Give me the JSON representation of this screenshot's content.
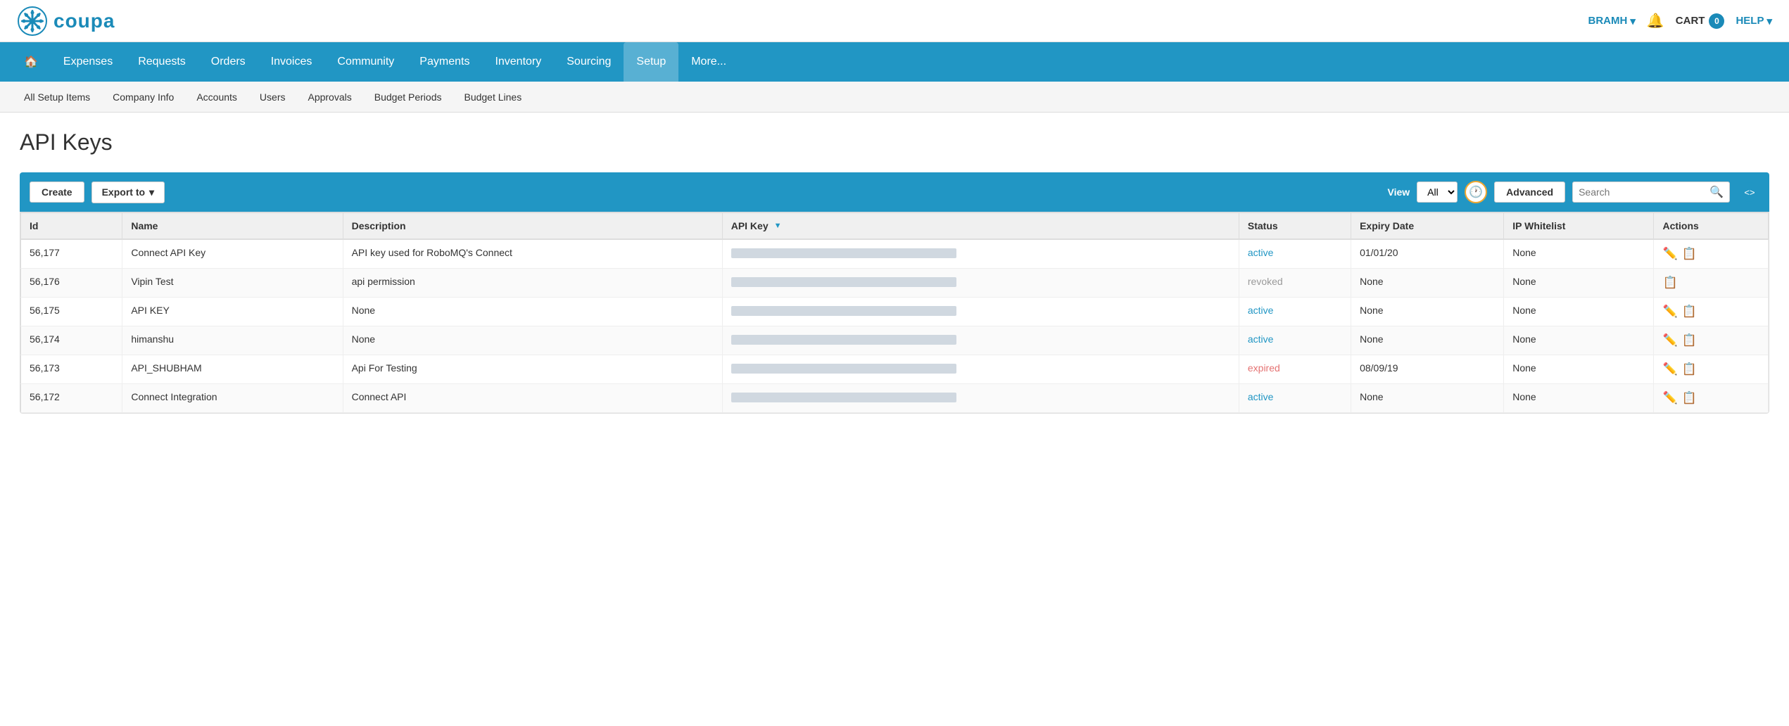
{
  "header": {
    "logo_text": "coupa",
    "user": "BRAMH",
    "cart_label": "CART",
    "cart_count": "0",
    "help_label": "HELP"
  },
  "nav": {
    "home_icon": "🏠",
    "items": [
      {
        "label": "Expenses"
      },
      {
        "label": "Requests"
      },
      {
        "label": "Orders"
      },
      {
        "label": "Invoices"
      },
      {
        "label": "Community"
      },
      {
        "label": "Payments"
      },
      {
        "label": "Inventory"
      },
      {
        "label": "Sourcing"
      },
      {
        "label": "Setup",
        "active": true
      },
      {
        "label": "More..."
      }
    ]
  },
  "sub_nav": {
    "items": [
      {
        "label": "All Setup Items"
      },
      {
        "label": "Company Info"
      },
      {
        "label": "Accounts"
      },
      {
        "label": "Users"
      },
      {
        "label": "Approvals"
      },
      {
        "label": "Budget Periods"
      },
      {
        "label": "Budget Lines"
      }
    ]
  },
  "page": {
    "title": "API Keys"
  },
  "toolbar": {
    "create_label": "Create",
    "export_label": "Export to",
    "view_label": "View",
    "view_options": [
      "All"
    ],
    "view_selected": "All",
    "advanced_label": "Advanced",
    "search_placeholder": "Search"
  },
  "table": {
    "columns": [
      "Id",
      "Name",
      "Description",
      "API Key",
      "Status",
      "Expiry Date",
      "IP Whitelist",
      "Actions"
    ],
    "rows": [
      {
        "id": "56,177",
        "name": "Connect API Key",
        "description": "API key used for RoboMQ's Connect",
        "status": "active",
        "expiry": "01/01/20",
        "ip": "None",
        "has_edit": true
      },
      {
        "id": "56,176",
        "name": "Vipin Test",
        "description": "api permission",
        "status": "revoked",
        "expiry": "None",
        "ip": "None",
        "has_edit": false
      },
      {
        "id": "56,175",
        "name": "API KEY",
        "description": "None",
        "status": "active",
        "expiry": "None",
        "ip": "None",
        "has_edit": true
      },
      {
        "id": "56,174",
        "name": "himanshu",
        "description": "None",
        "status": "active",
        "expiry": "None",
        "ip": "None",
        "has_edit": true
      },
      {
        "id": "56,173",
        "name": "API_SHUBHAM",
        "description": "Api For Testing",
        "status": "expired",
        "expiry": "08/09/19",
        "ip": "None",
        "has_edit": true
      },
      {
        "id": "56,172",
        "name": "Connect Integration",
        "description": "Connect API",
        "status": "active",
        "expiry": "None",
        "ip": "None",
        "has_edit": true
      }
    ]
  }
}
